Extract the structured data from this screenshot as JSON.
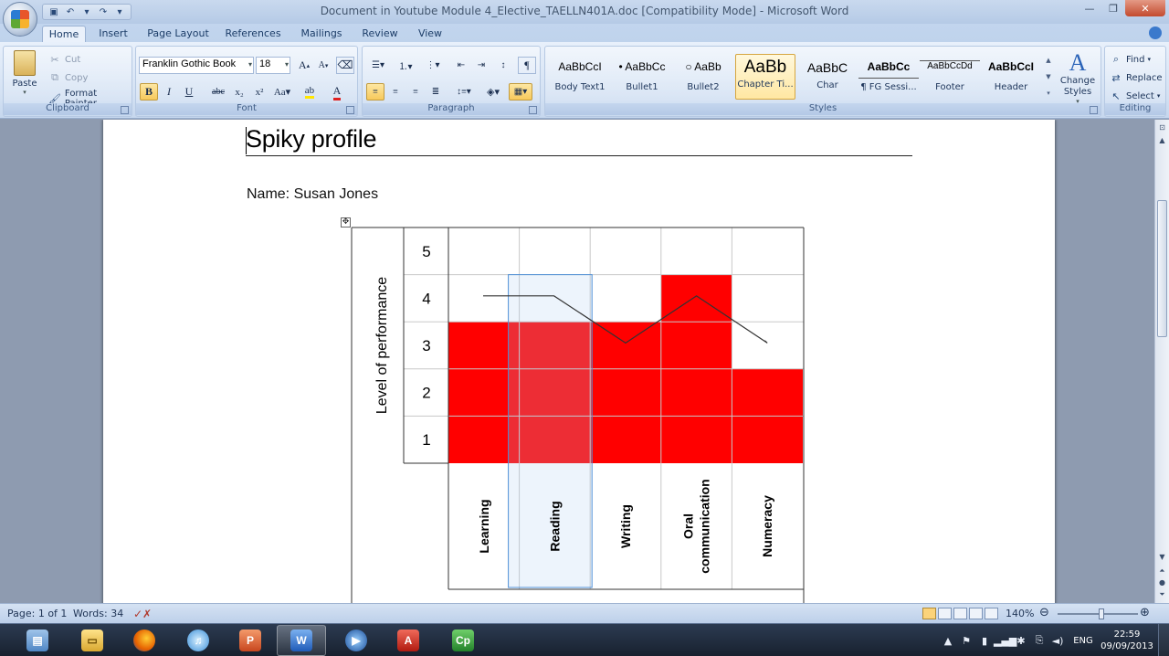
{
  "window": {
    "title": "Document in Youtube Module 4_Elective_TAELLN401A.doc [Compatibility Mode] - Microsoft Word"
  },
  "tabs": [
    "Home",
    "Insert",
    "Page Layout",
    "References",
    "Mailings",
    "Review",
    "View"
  ],
  "active_tab": "Home",
  "ribbon": {
    "clipboard": {
      "label": "Clipboard",
      "paste": "Paste",
      "cut": "Cut",
      "copy": "Copy",
      "format_painter": "Format Painter"
    },
    "font": {
      "label": "Font",
      "family": "Franklin Gothic Book",
      "size": "18"
    },
    "paragraph": {
      "label": "Paragraph"
    },
    "styles": {
      "label": "Styles",
      "items": [
        {
          "sample": "AaBbCcI",
          "name": "Body Text1"
        },
        {
          "sample": "• AaBbCc",
          "name": "Bullet1"
        },
        {
          "sample": "○ AaBb",
          "name": "Bullet2"
        },
        {
          "sample": "AaBb",
          "name": "Chapter Ti..."
        },
        {
          "sample": "AaBbC",
          "name": "Char"
        },
        {
          "sample": "AaBbCc",
          "name": "¶ FG Sessi..."
        },
        {
          "sample": "AaBbCcDd",
          "name": "Footer"
        },
        {
          "sample": "AaBbCcI",
          "name": "Header"
        }
      ],
      "selected": 3,
      "change_styles": "Change Styles"
    },
    "editing": {
      "label": "Editing",
      "find": "Find",
      "replace": "Replace",
      "select": "Select"
    }
  },
  "document": {
    "heading": "Spiky profile",
    "name_line": "Name: Susan Jones"
  },
  "chart_data": {
    "type": "bar",
    "categories": [
      "Learning",
      "Reading",
      "Writing",
      "Oral communication",
      "Numeracy"
    ],
    "values": [
      3,
      3,
      3,
      4,
      2
    ],
    "line_values": [
      4,
      4,
      3,
      4,
      3
    ],
    "ylabel": "Level of performance",
    "ylim": [
      0,
      5
    ],
    "yticks": [
      "5",
      "4",
      "3",
      "2",
      "1"
    ],
    "bar_color": "#ff0000",
    "highlighted_column": "Reading"
  },
  "status": {
    "page": "Page: 1 of 1",
    "words": "Words: 34",
    "zoom": "140%",
    "zoom_level": 140
  },
  "taskbar": {
    "language": "ENG",
    "time": "22:59",
    "date": "09/09/2013"
  }
}
